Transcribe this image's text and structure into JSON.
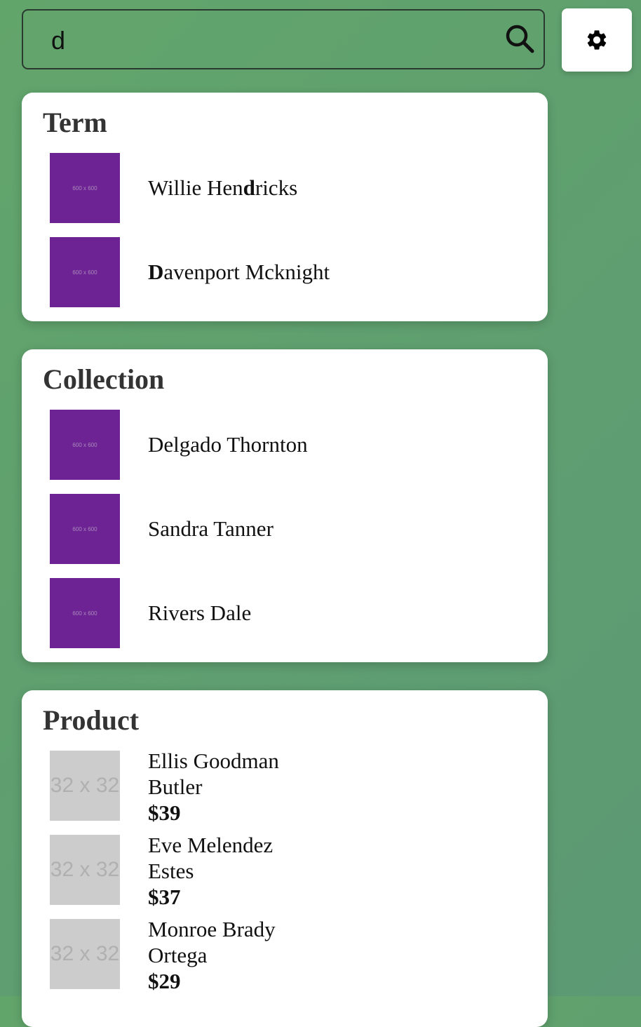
{
  "search": {
    "value": "d",
    "icon": "search-icon"
  },
  "settings": {
    "icon": "gear-icon"
  },
  "term": {
    "title": "Term",
    "items": [
      {
        "pre": "Willie Hen",
        "match": "d",
        "post": "ricks",
        "thumb": "600 x 600"
      },
      {
        "pre": "",
        "match": "D",
        "post": "avenport Mcknight",
        "thumb": "600 x 600"
      }
    ]
  },
  "collection": {
    "title": "Collection",
    "items": [
      {
        "label": "Delgado Thornton",
        "thumb": "600 x 600"
      },
      {
        "label": "Sandra Tanner",
        "thumb": "600 x 600"
      },
      {
        "label": "Rivers Dale",
        "thumb": "600 x 600"
      }
    ]
  },
  "product": {
    "title": "Product",
    "items": [
      {
        "name_line1": "Ellis Goodman",
        "name_line2": "Butler",
        "price": "$39",
        "thumb": "32 x 32"
      },
      {
        "name_line1": "Eve Melendez",
        "name_line2": "Estes",
        "price": "$37",
        "thumb": "32 x 32"
      },
      {
        "name_line1": "Monroe Brady",
        "name_line2": "Ortega",
        "price": "$29",
        "thumb": "32 x 32"
      }
    ]
  },
  "colors": {
    "background": "#5f9e70",
    "thumb_purple": "#6e2394",
    "thumb_gray": "#cccccc",
    "panel": "#ffffff",
    "heading": "#333333"
  }
}
